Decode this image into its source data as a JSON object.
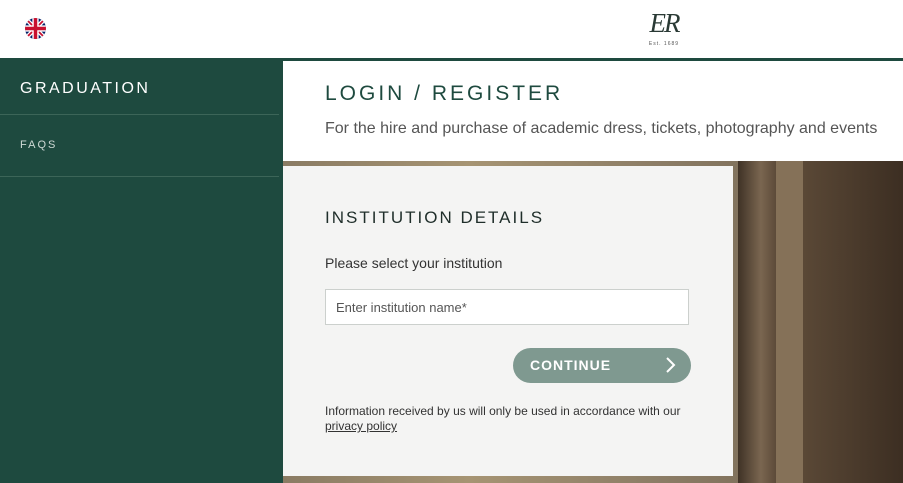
{
  "header": {
    "flag_icon": "uk-flag-icon",
    "logo_text": "ER",
    "logo_sub": "Est. 1689"
  },
  "sidebar": {
    "items": [
      {
        "label": "GRADUATION"
      },
      {
        "label": "FAQS"
      }
    ]
  },
  "main": {
    "title": "LOGIN / REGISTER",
    "subtitle": "For the hire and purchase of academic dress, tickets, photography and events"
  },
  "card": {
    "title": "INSTITUTION DETAILS",
    "label": "Please select your institution",
    "input_placeholder": "Enter institution name*",
    "input_value": "",
    "continue_label": "CONTINUE",
    "continue_icon": "chevron-right-icon",
    "notice_text": "Information received by us will only be used in accordance with our ",
    "privacy_link": "privacy policy"
  },
  "colors": {
    "brand_green": "#1e4a3f",
    "button": "#7f9990",
    "card_bg": "#f4f4f3"
  }
}
